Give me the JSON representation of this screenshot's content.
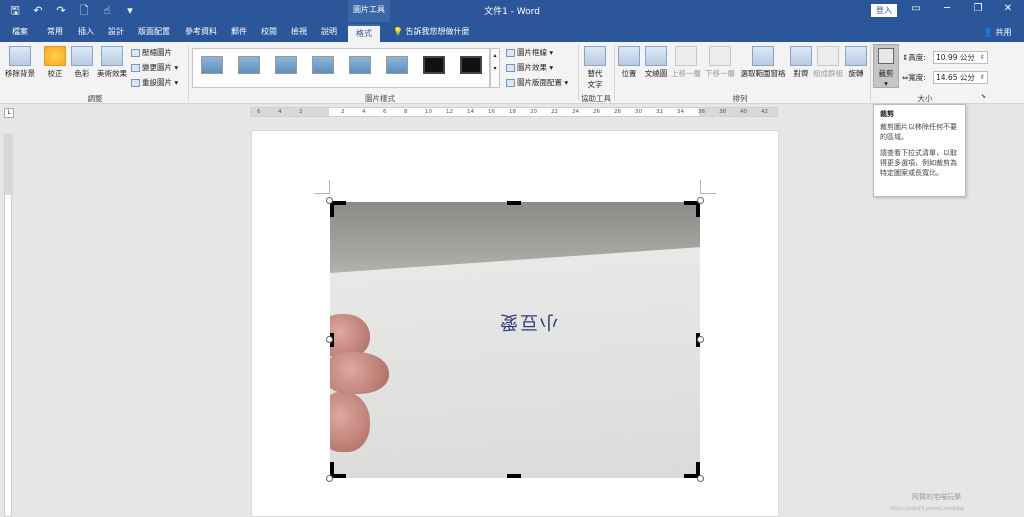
{
  "titlebar": {
    "contextual_group": "圖片工具",
    "document_title": "文件1 - Word",
    "login_label": "登入",
    "controls": [
      "▭",
      "─",
      "❐",
      "✕"
    ]
  },
  "tabs": [
    {
      "label": "檔案"
    },
    {
      "label": "常用"
    },
    {
      "label": "插入"
    },
    {
      "label": "設計"
    },
    {
      "label": "版面配置"
    },
    {
      "label": "參考資料"
    },
    {
      "label": "郵件"
    },
    {
      "label": "校閱"
    },
    {
      "label": "檢視"
    },
    {
      "label": "說明"
    },
    {
      "label": "格式",
      "active": true
    }
  ],
  "tellme": "告訴我您想做什麼",
  "share": "共用",
  "ribbon": {
    "adjust": {
      "remove_bg": "移除背景",
      "corrections": "校正",
      "color": "色彩",
      "artistic": "美術效果",
      "compress": "壓縮圖片",
      "change": "變更圖片",
      "reset": "重設圖片",
      "label": "調整"
    },
    "styles": {
      "border": "圖片框線",
      "effects": "圖片效果",
      "layout": "圖片版面配置",
      "label": "圖片樣式"
    },
    "accessibility": {
      "alt_text_line1": "替代",
      "alt_text_line2": "文字",
      "label": "協助工具"
    },
    "arrange": {
      "position": "位置",
      "wrap": "文繞圖",
      "forward": "上移一層",
      "backward": "下移一層",
      "selection": "選取範圍窗格",
      "align": "對齊",
      "group": "組成群組",
      "rotate": "旋轉",
      "label": "排列"
    },
    "size": {
      "crop": "裁剪",
      "height_label": "高度:",
      "height_value": "10.99 公分",
      "width_label": "寬度:",
      "width_value": "14.65 公分",
      "label": "大小"
    }
  },
  "ruler": {
    "h_ticks": [
      "6",
      "4",
      "2",
      "",
      "2",
      "4",
      "6",
      "8",
      "10",
      "12",
      "14",
      "16",
      "18",
      "20",
      "22",
      "24",
      "26",
      "28",
      "30",
      "32",
      "34",
      "36",
      "38",
      "40",
      "42"
    ]
  },
  "photo": {
    "handwriting": "小豆愛"
  },
  "tooltip": {
    "title": "裁剪",
    "line1": "裁剪圖片以移除任何不要的區域。",
    "line2": "請查看下拉式清單，以取得更多選項，例如裁剪為特定圖案或長寬比。"
  },
  "watermark": "阿贊的宅喵玩樂",
  "watermark2": "https://jsan15.pixnet.net/blog"
}
